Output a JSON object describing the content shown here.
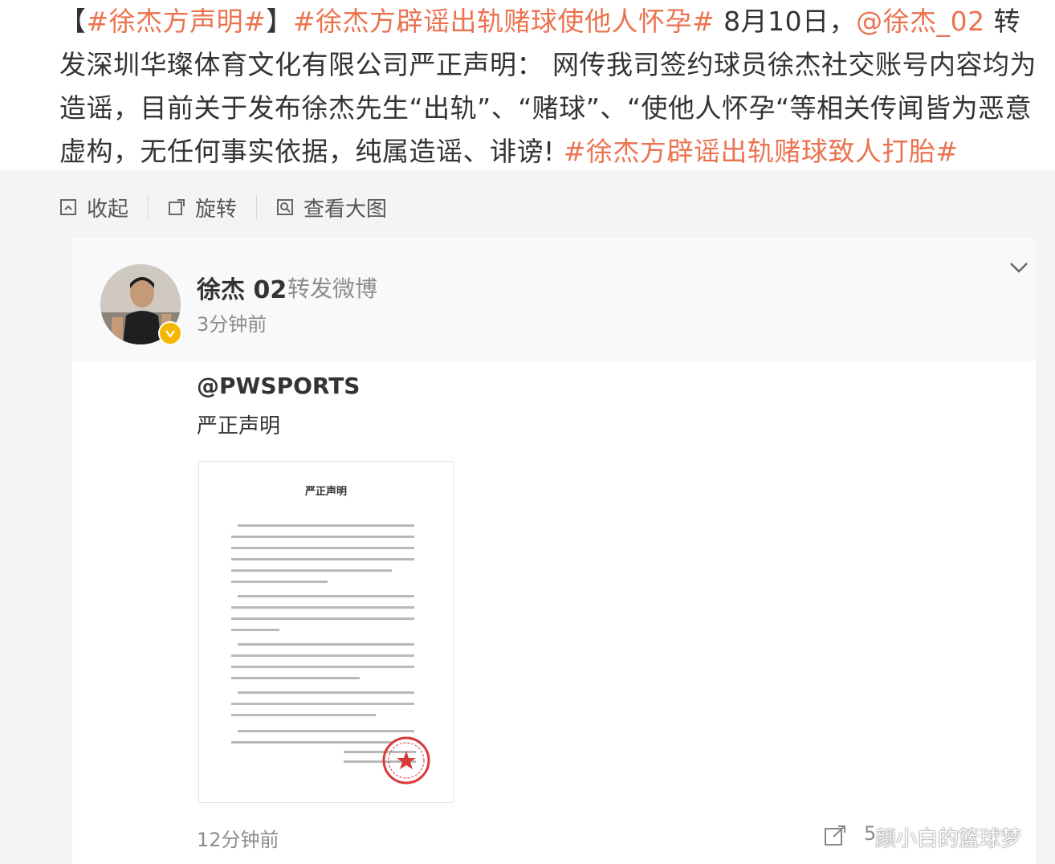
{
  "post": {
    "segments": [
      {
        "text": "【",
        "type": "text"
      },
      {
        "text": "#徐杰方声明#",
        "type": "tag"
      },
      {
        "text": "】",
        "type": "text"
      },
      {
        "text": "#徐杰方辟谣出轨赌球使他人怀孕#",
        "type": "tag"
      },
      {
        "text": " 8月10日，",
        "type": "text"
      },
      {
        "text": "@徐杰_02",
        "type": "mention"
      },
      {
        "text": " 转发深圳华璨体育文化有限公司严正声明： 网传我司签约球员徐杰社交账号内容均为造谣，目前关于发布徐杰先生“出轨”、“赌球”、“使他人怀孕“等相关传闻皆为恶意虚构，无任何事实依据，纯属造谣、诽谤! ",
        "type": "text"
      },
      {
        "text": "#徐杰方辟谣出轨赌球致人打胎#",
        "type": "tag"
      }
    ]
  },
  "toolbar": {
    "collapse_label": "收起",
    "rotate_label": "旋转",
    "view_large_label": "查看大图"
  },
  "card": {
    "username": "徐杰 02",
    "action": "转发微博",
    "time": "3分钟前",
    "original_author": "@PWSPORTS",
    "original_text": "严正声明",
    "document_title": "严正声明",
    "footer_time": "12分钟前",
    "share_count": "5"
  },
  "watermark": "颜小白的篮球梦",
  "colors": {
    "link": "#eb7350",
    "media_bg": "#f4f4f6",
    "verified_badge": "#f5b800",
    "seal": "#d63a3a"
  }
}
